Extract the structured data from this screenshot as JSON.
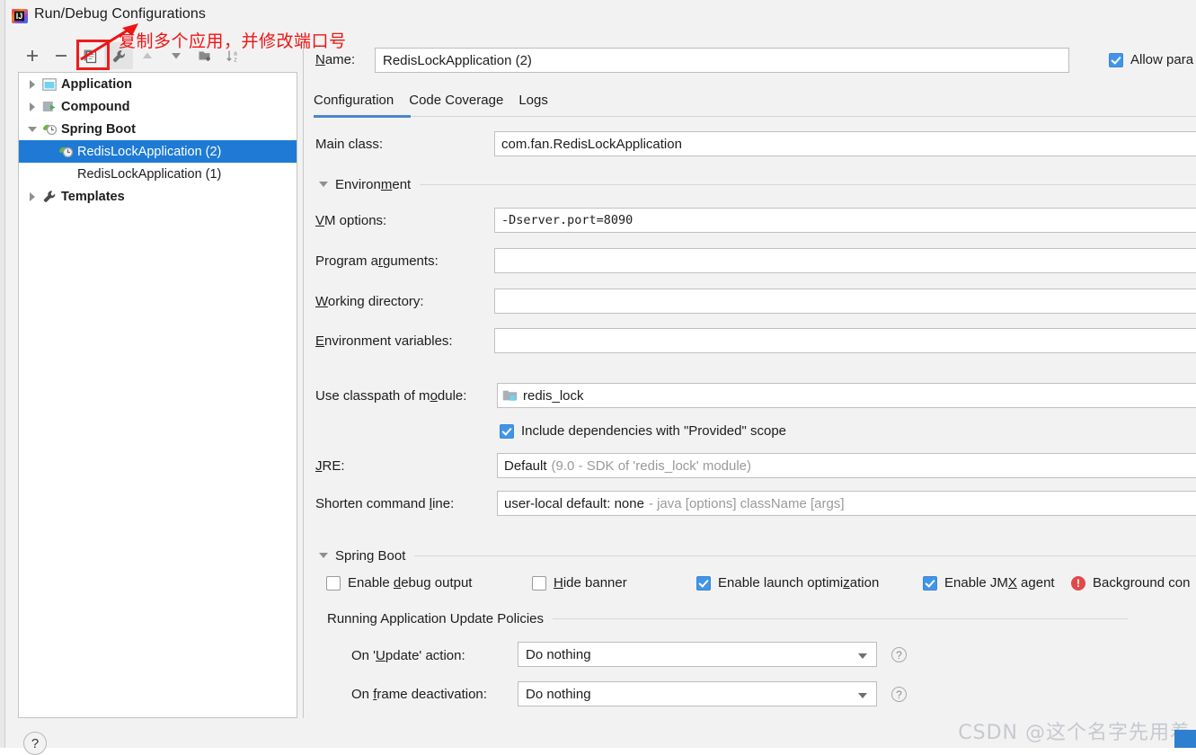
{
  "window": {
    "title": "Run/Debug Configurations",
    "app_icon": "intellij-idea-logo"
  },
  "annotation": {
    "text": "复制多个应用，并修改端口号",
    "color": "#f01414"
  },
  "toolbar": {
    "buttons": [
      {
        "name": "add",
        "icon": "plus-icon",
        "label": "+"
      },
      {
        "name": "remove",
        "icon": "minus-icon",
        "label": "−"
      },
      {
        "name": "copy",
        "icon": "copy-icon",
        "label": ""
      },
      {
        "name": "edit-templates",
        "icon": "wrench-icon",
        "label": ""
      },
      {
        "name": "move-up",
        "icon": "arrow-up-icon",
        "label": ""
      },
      {
        "name": "move-down",
        "icon": "arrow-down-icon",
        "label": ""
      },
      {
        "name": "create-folder",
        "icon": "folder-add-icon",
        "label": ""
      },
      {
        "name": "sort-alphabetically",
        "icon": "sort-az-icon",
        "label": ""
      }
    ]
  },
  "tree": {
    "items": [
      {
        "label": "Application",
        "icon": "application-icon",
        "expander": "collapsed",
        "bold": true,
        "indent": 0,
        "selected": false
      },
      {
        "label": "Compound",
        "icon": "compound-icon",
        "expander": "collapsed",
        "bold": true,
        "indent": 0,
        "selected": false
      },
      {
        "label": "Spring Boot",
        "icon": "spring-boot-icon",
        "expander": "expanded",
        "bold": true,
        "indent": 0,
        "selected": false
      },
      {
        "label": "RedisLockApplication (2)",
        "icon": "spring-boot-icon",
        "expander": "none",
        "bold": false,
        "indent": 1,
        "selected": true
      },
      {
        "label": "RedisLockApplication (1)",
        "icon": "none",
        "expander": "none",
        "bold": false,
        "indent": 2,
        "selected": false
      },
      {
        "label": "Templates",
        "icon": "wrench-icon",
        "expander": "collapsed",
        "bold": true,
        "indent": 0,
        "selected": false
      }
    ]
  },
  "name_row": {
    "label": "Name:",
    "label_mnemonic": "N",
    "value": "RedisLockApplication (2)",
    "allow_parallel": {
      "label": "Allow para",
      "checked": true
    }
  },
  "tabs": [
    {
      "label": "Configuration",
      "active": true
    },
    {
      "label": "Code Coverage",
      "active": false
    },
    {
      "label": "Logs",
      "active": false
    }
  ],
  "configuration": {
    "main_class": {
      "label": "Main class:",
      "value": "com.fan.RedisLockApplication"
    },
    "environment_section": {
      "label": "Environment",
      "expanded": true
    },
    "vm_options": {
      "label": "VM options:",
      "mnemonic": "V",
      "value": "-Dserver.port=8090"
    },
    "program_arguments": {
      "label": "Program arguments:",
      "mnemonic": "r",
      "value": ""
    },
    "working_directory": {
      "label": "Working directory:",
      "mnemonic": "W",
      "value": ""
    },
    "environment_variables": {
      "label": "Environment variables:",
      "mnemonic": "E",
      "value": ""
    },
    "use_classpath": {
      "label": "Use classpath of module:",
      "mnemonic": "o",
      "value": "redis_lock",
      "icon": "module-icon"
    },
    "include_provided": {
      "label": "Include dependencies with \"Provided\" scope",
      "checked": true
    },
    "jre": {
      "label": "JRE:",
      "mnemonic": "J",
      "value_strong": "Default",
      "value_muted": "(9.0 - SDK of 'redis_lock' module)"
    },
    "shorten_command_line": {
      "label": "Shorten command line:",
      "mnemonic": "l",
      "value_strong": "user-local default: none",
      "value_muted": "- java [options] className [args]"
    }
  },
  "spring_boot_section": {
    "label": "Spring Boot",
    "expanded": true,
    "checkboxes": [
      {
        "label": "Enable debug output",
        "mnemonic": "d",
        "checked": false
      },
      {
        "label": "Hide banner",
        "mnemonic": "H",
        "checked": false
      },
      {
        "label": "Enable launch optimization",
        "mnemonic": "z",
        "checked": true
      },
      {
        "label": "Enable JMX agent",
        "mnemonic": "X",
        "checked": true
      }
    ],
    "background_warning": {
      "label": "Background con",
      "icon": "error-icon"
    }
  },
  "update_policies": {
    "title": "Running Application Update Policies",
    "rows": [
      {
        "label": "On 'Update' action:",
        "mnemonic": "U",
        "value": "Do nothing",
        "help": "?"
      },
      {
        "label": "On frame deactivation:",
        "mnemonic": "f",
        "value": "Do nothing",
        "help": "?"
      }
    ]
  },
  "footer": {
    "help_button": "?",
    "watermark": "CSDN @这个名字先用着"
  },
  "colors": {
    "selection_blue": "#1e7ad4",
    "accent_blue": "#4294e8",
    "tab_underline": "#4a87c8",
    "annotation_red": "#f01414",
    "warning_red": "#e04a4a",
    "panel_bg": "#f2f2f2",
    "field_bg": "#ffffff"
  }
}
